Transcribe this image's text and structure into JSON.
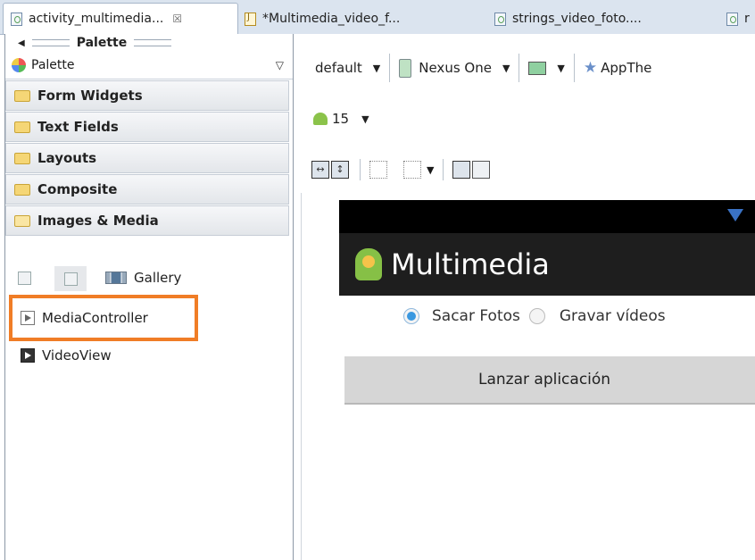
{
  "tabs": [
    {
      "label": "activity_multimedia...",
      "close": "☒"
    },
    {
      "label": "*Multimedia_video_f..."
    },
    {
      "label": "strings_video_foto...."
    },
    {
      "label": "r"
    }
  ],
  "palette": {
    "header": "Palette",
    "selector": "Palette",
    "categories": [
      "Form Widgets",
      "Text Fields",
      "Layouts",
      "Composite",
      "Images & Media"
    ],
    "items": {
      "gallery": "Gallery",
      "media_controller": "MediaController",
      "video_view": "VideoView"
    }
  },
  "toolbar": {
    "config": "default",
    "device": "Nexus One",
    "theme": "AppThe",
    "api_level": "15"
  },
  "preview": {
    "app_title": "Multimedia",
    "radio_options": [
      {
        "label": "Sacar Fotos",
        "selected": true
      },
      {
        "label": "Gravar vídeos",
        "selected": false
      }
    ],
    "button_label": "Lanzar aplicación"
  },
  "colors": {
    "highlight": "#f07d26",
    "radio_selected": "#3a98e0",
    "action_bar": "#1e1e1e"
  }
}
